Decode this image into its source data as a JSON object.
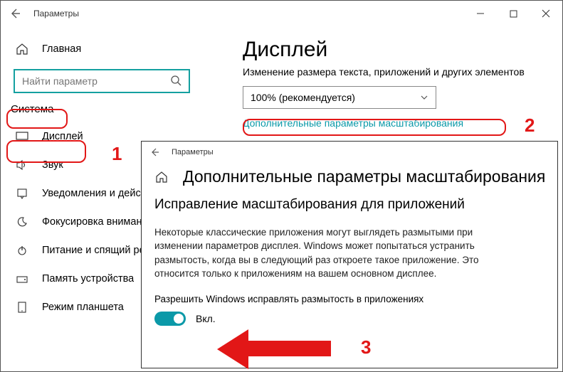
{
  "window": {
    "title": "Параметры"
  },
  "sidebar": {
    "home": "Главная",
    "search_placeholder": "Найти параметр",
    "category": "Система",
    "items": [
      {
        "label": "Дисплей"
      },
      {
        "label": "Звук"
      },
      {
        "label": "Уведомления и действия"
      },
      {
        "label": "Фокусировка внимания"
      },
      {
        "label": "Питание и спящий режим"
      },
      {
        "label": "Память устройства"
      },
      {
        "label": "Режим планшета"
      }
    ]
  },
  "content": {
    "title": "Дисплей",
    "scale_section_label": "Изменение размера текста, приложений и других элементов",
    "scale_value": "100% (рекомендуется)",
    "advanced_link": "Дополнительные параметры масштабирования"
  },
  "overlay": {
    "title_small": "Параметры",
    "heading": "Дополнительные параметры масштабирования",
    "subheading": "Исправление масштабирования для приложений",
    "body_text": "Некоторые классические приложения могут выглядеть размытыми при изменении параметров дисплея. Windows может попытаться устранить размытость, когда вы в следующий раз откроете такое приложение. Это относится только к приложениям на вашем основном дисплее.",
    "toggle_caption": "Разрешить Windows исправлять размытость в приложениях",
    "toggle_state_label": "Вкл."
  },
  "annotations": {
    "n1": "1",
    "n2": "2",
    "n3": "3"
  }
}
